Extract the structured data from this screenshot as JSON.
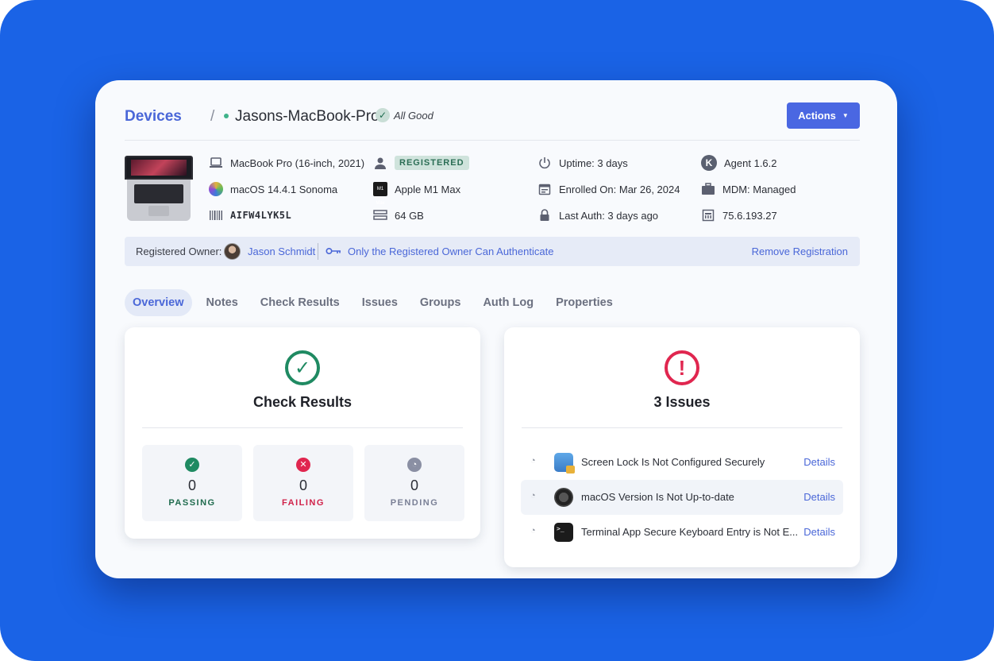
{
  "breadcrumb": {
    "root": "Devices",
    "separator": "/",
    "device_name": "Jasons-MacBook-Pro",
    "status": "All Good"
  },
  "header": {
    "actions_label": "Actions"
  },
  "device_info": {
    "model": "MacBook Pro (16-inch, 2021)",
    "os": "macOS 14.4.1 Sonoma",
    "serial": "AIFW4LYK5L",
    "registration_badge": "REGISTERED",
    "chip": "Apple M1 Max",
    "chip_icon_text": "M1 Max",
    "memory": "64 GB",
    "uptime": "Uptime: 3 days",
    "enrolled": "Enrolled On: Mar 26, 2024",
    "last_auth": "Last Auth: 3 days ago",
    "agent": "Agent 1.6.2",
    "mdm": "MDM: Managed",
    "ip": "75.6.193.27"
  },
  "owner_bar": {
    "label": "Registered Owner:",
    "owner_name": "Jason Schmidt",
    "auth_policy": "Only the Registered Owner Can Authenticate",
    "remove_label": "Remove Registration"
  },
  "tabs": [
    {
      "label": "Overview",
      "active": true
    },
    {
      "label": "Notes"
    },
    {
      "label": "Check Results"
    },
    {
      "label": "Issues"
    },
    {
      "label": "Groups"
    },
    {
      "label": "Auth Log"
    },
    {
      "label": "Properties"
    }
  ],
  "check_results": {
    "title": "Check Results",
    "passing": {
      "count": "0",
      "label": "PASSING",
      "color": "#1f8a62"
    },
    "failing": {
      "count": "0",
      "label": "FAILING",
      "color": "#e0264f"
    },
    "pending": {
      "count": "0",
      "label": "PENDING",
      "color": "#8a8fa3"
    }
  },
  "issues": {
    "title": "3 Issues",
    "items": [
      {
        "text": "Screen Lock Is Not Configured Securely",
        "details": "Details",
        "icon": "screen-lock-app-icon"
      },
      {
        "text": "macOS Version Is Not Up-to-date",
        "details": "Details",
        "icon": "macos-app-icon"
      },
      {
        "text": "Terminal App Secure Keyboard Entry is Not E...",
        "details": "Details",
        "icon": "terminal-app-icon"
      }
    ]
  },
  "colors": {
    "accent": "#4a67d8",
    "background": "#1a63e6",
    "success": "#1f8a62",
    "danger": "#e0264f"
  }
}
